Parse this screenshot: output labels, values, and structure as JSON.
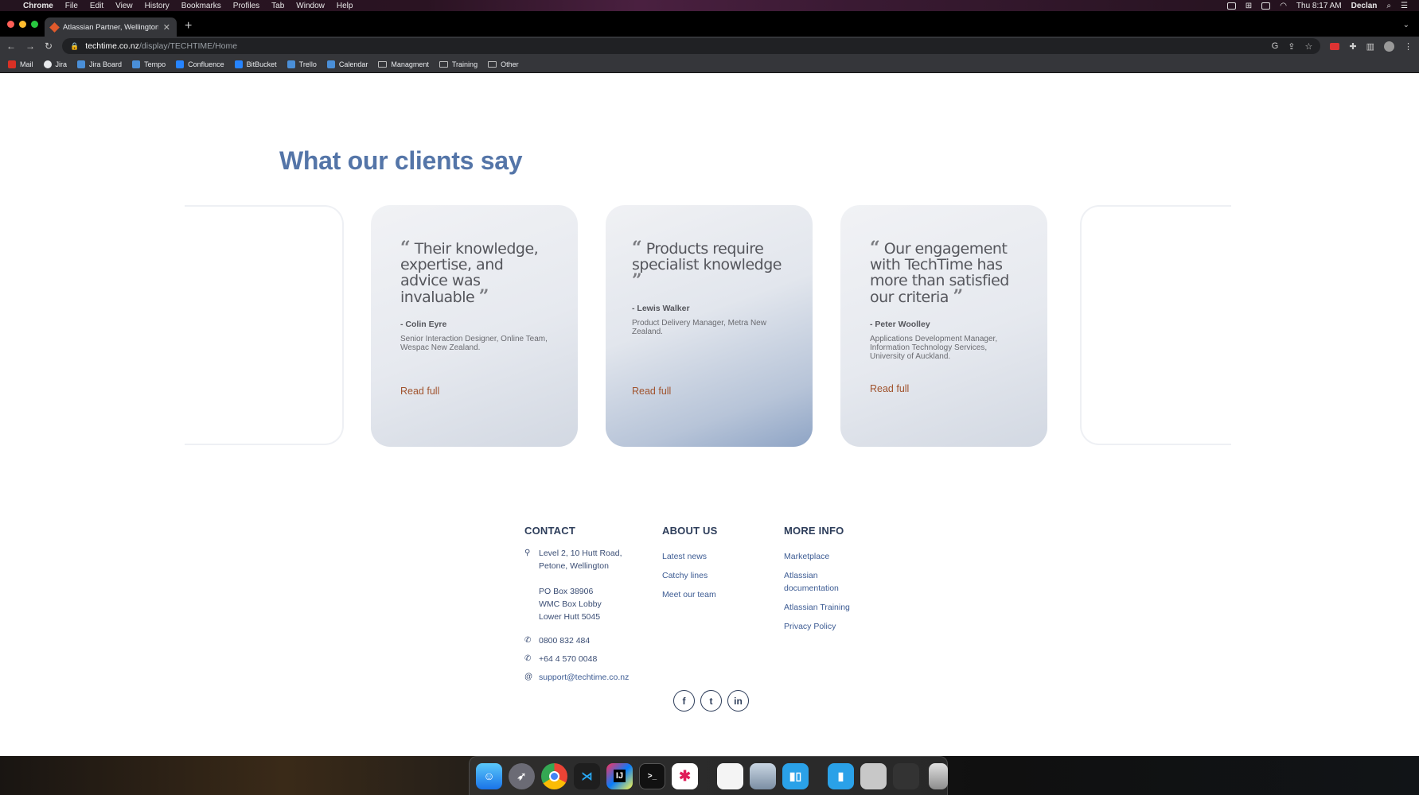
{
  "menubar": {
    "apple": "",
    "app_name": "Chrome",
    "menus": [
      "File",
      "Edit",
      "View",
      "History",
      "Bookmarks",
      "Profiles",
      "Tab",
      "Window",
      "Help"
    ],
    "clock": "Thu 8:17 AM",
    "user": "Declan"
  },
  "browser": {
    "tab_title": "Atlassian Partner, Wellington -",
    "url_host": "techtime.co.nz",
    "url_path": "/display/TECHTIME/Home",
    "bookmarks": [
      {
        "label": "Mail",
        "icon": "gmail-icon",
        "color": "#d93025"
      },
      {
        "label": "Jira",
        "icon": "jira-icon",
        "color": "#e8eaed"
      },
      {
        "label": "Jira Board",
        "icon": "jira-board-icon",
        "color": "#4a8fd8"
      },
      {
        "label": "Tempo",
        "icon": "tempo-icon",
        "color": "#4a8fd8"
      },
      {
        "label": "Confluence",
        "icon": "confluence-icon",
        "color": "#2684ff"
      },
      {
        "label": "BitBucket",
        "icon": "bitbucket-icon",
        "color": "#2684ff"
      },
      {
        "label": "Trello",
        "icon": "trello-icon",
        "color": "#4a8fd8"
      },
      {
        "label": "Calendar",
        "icon": "calendar-icon",
        "color": "#4a8fd8"
      },
      {
        "label": "Managment",
        "icon": "folder-icon",
        "color": ""
      },
      {
        "label": "Training",
        "icon": "folder-icon",
        "color": ""
      },
      {
        "label": "Other",
        "icon": "folder-icon",
        "color": ""
      }
    ]
  },
  "testimonials": {
    "heading": "What our clients say",
    "cards": [
      {
        "quote": "Their knowledge, expertise, and advice was invaluable",
        "author": "- Colin Eyre",
        "role": "Senior Interaction Designer, Online Team, Wespac New Zealand.",
        "link": "Read full"
      },
      {
        "quote": "Products require specialist knowledge",
        "author": "- Lewis Walker",
        "role": "Product Delivery Manager, Metra New Zealand.",
        "link": "Read full"
      },
      {
        "quote": "Our engagement with TechTime has more than satisfied our criteria",
        "author": "- Peter Woolley",
        "role": "Applications Development Manager, Information Technology Services, University of Auckland.",
        "link": "Read full"
      }
    ]
  },
  "footer": {
    "contact": {
      "heading": "CONTACT",
      "address1": "Level 2, 10 Hutt Road,",
      "address2": "Petone, Wellington",
      "po1": "PO Box 38906",
      "po2": "WMC Box Lobby",
      "po3": "Lower Hutt 5045",
      "phone1": "0800 832 484",
      "phone2": "+64 4 570 0048",
      "email": "support@techtime.co.nz"
    },
    "about": {
      "heading": "ABOUT US",
      "links": [
        "Latest news",
        "Catchy lines",
        "Meet our team"
      ]
    },
    "more": {
      "heading": "MORE INFO",
      "links": [
        "Marketplace",
        "Atlassian",
        "documentation",
        "Atlassian Training",
        "Privacy Policy"
      ]
    },
    "social": {
      "facebook": "f",
      "twitter": "t",
      "linkedin": "in"
    }
  },
  "colors": {
    "heading": "#5475a8",
    "link_orange": "#a0532d",
    "footer_navy": "#2d3d5a",
    "footer_link": "#3c5b93"
  }
}
